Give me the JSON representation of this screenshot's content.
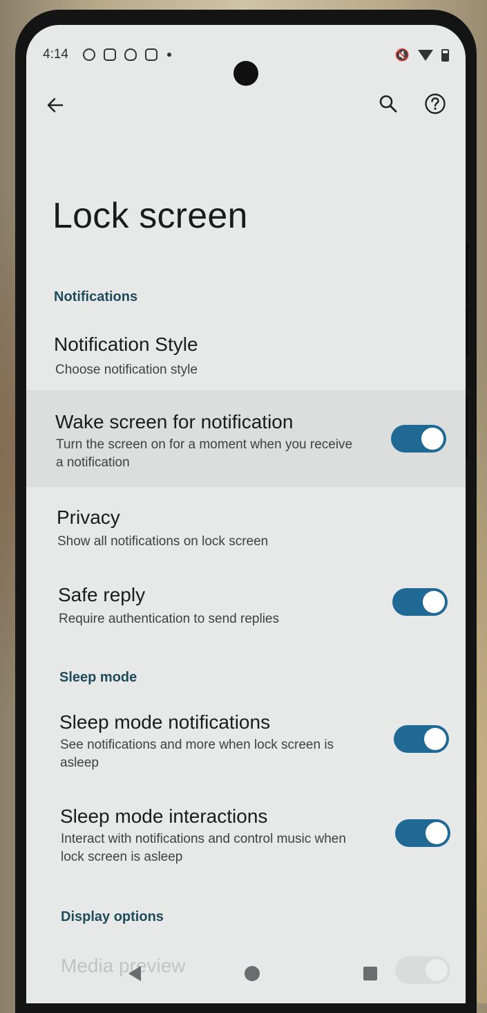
{
  "status_bar": {
    "time": "4:14",
    "left_icons": [
      "notification-icon-1",
      "sim-icon",
      "shield-icon",
      "clipboard-icon",
      "more-dot-icon"
    ],
    "right_icons": [
      "mute-icon",
      "wifi-icon",
      "battery-icon"
    ]
  },
  "top_bar": {
    "back_icon": "arrow-left-icon",
    "search_icon": "search-icon",
    "help_icon": "help-circle-icon"
  },
  "page": {
    "title": "Lock screen"
  },
  "sections": [
    {
      "header": "Notifications",
      "items": [
        {
          "title": "Notification Style",
          "subtitle": "Choose notification style"
        },
        {
          "title": "Wake screen for notification",
          "subtitle": "Turn the screen on for a moment when you receive a notification",
          "toggle": true
        },
        {
          "title": "Privacy",
          "subtitle": "Show all notifications on lock screen"
        },
        {
          "title": "Safe reply",
          "subtitle": "Require authentication to send replies",
          "toggle": true
        }
      ]
    },
    {
      "header": "Sleep mode",
      "items": [
        {
          "title": "Sleep mode notifications",
          "subtitle": "See notifications and more when lock screen is asleep",
          "toggle": true
        },
        {
          "title": "Sleep mode interactions",
          "subtitle": "Interact with notifications and control music when lock screen is asleep",
          "toggle": true
        }
      ]
    },
    {
      "header": "Display options",
      "items": [
        {
          "title": "Media preview"
        }
      ]
    }
  ],
  "colors": {
    "accent": "#1f6994",
    "section_header": "#1f4b5a",
    "background": "#e7e9e8"
  }
}
